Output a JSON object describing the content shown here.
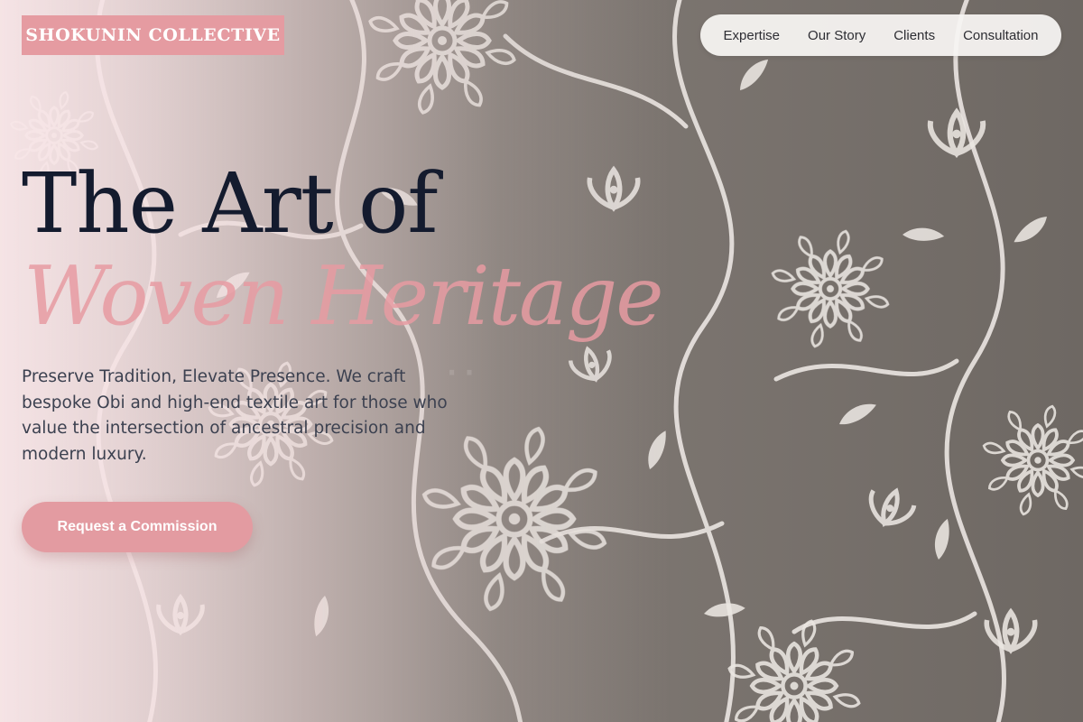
{
  "brand": {
    "logo_text": "SHOKUNIN COLLECTIVE"
  },
  "nav": {
    "items": [
      {
        "label": "Expertise"
      },
      {
        "label": "Our Story"
      },
      {
        "label": "Clients"
      },
      {
        "label": "Consultation"
      }
    ]
  },
  "hero": {
    "title_line1": "The Art of",
    "title_line2": "Woven Heritage",
    "subtitle": "Preserve Tradition, Elevate Presence. We craft bespoke Obi and high-end textile art for those who value the intersection of ancestral precision and modern luxury.",
    "cta_label": "Request a Commission"
  },
  "colors": {
    "accent_pink": "#e59ba1",
    "title_navy": "#141b2e",
    "body_text": "#3c4150",
    "fabric_gray": "#7d7772",
    "pattern_white": "#ebe6e2"
  }
}
